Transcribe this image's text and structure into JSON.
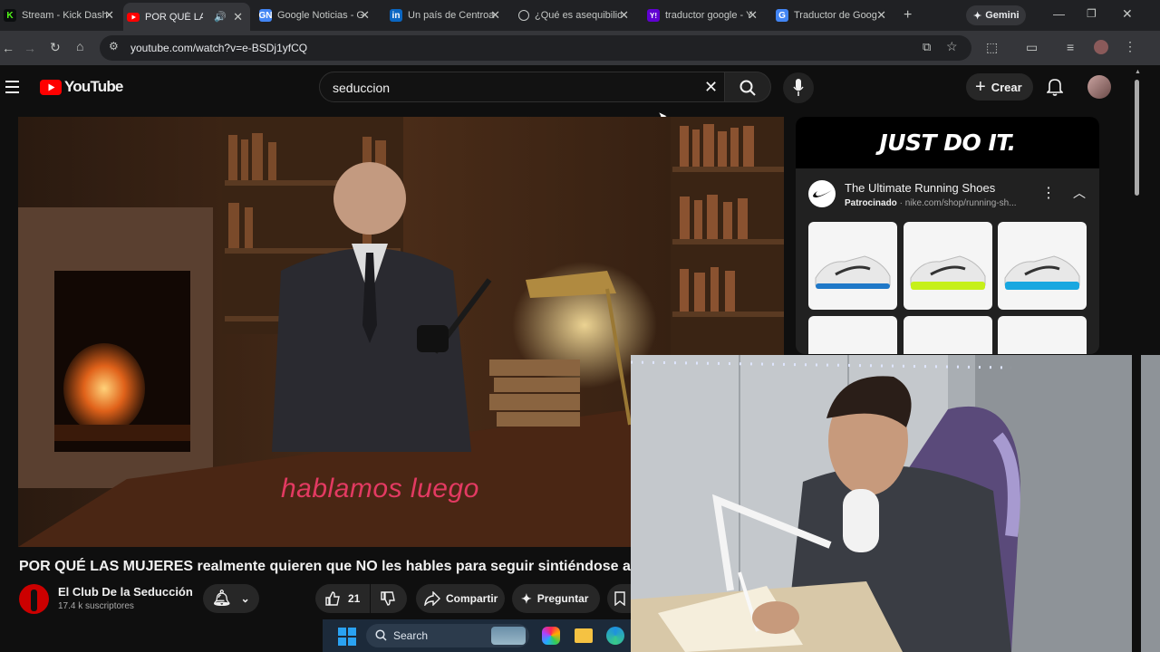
{
  "browser": {
    "tabs": [
      {
        "title": "Stream - Kick Dash",
        "favicon": "K",
        "favicon_color": "#53fc18",
        "active": false
      },
      {
        "title": "POR QUÉ LAS MUJ",
        "favicon": "youtube-icon",
        "favicon_color": "#ff0000",
        "active": true
      },
      {
        "title": "Google Noticias - G",
        "favicon": "G",
        "favicon_color": "#4285f4",
        "active": false
      },
      {
        "title": "Un país de Centroa",
        "favicon": "in",
        "favicon_color": "#0a66c2",
        "active": false
      },
      {
        "title": "¿Qué es asequibilida",
        "favicon": "chatgpt-icon",
        "favicon_color": "#c4c7c5",
        "active": false
      },
      {
        "title": "traductor google - Y",
        "favicon": "Y!",
        "favicon_color": "#6001d2",
        "active": false
      },
      {
        "title": "Traductor de Goog",
        "favicon": "G",
        "favicon_color": "#4285f4",
        "active": false
      }
    ],
    "gemini_label": "Gemini",
    "url": "youtube.com/watch?v=e-BSDj1yfCQ"
  },
  "youtube": {
    "logo_text": "YouTube",
    "search_value": "seduccion",
    "create_label": "Crear",
    "video": {
      "subtitle": "hablamos luego",
      "title": "POR QUÉ LAS MUJERES realmente quieren que NO les hables para seguir sintiéndose atra"
    },
    "channel": {
      "name": "El Club De la Seducción",
      "subscribers": "17.4 k suscriptores"
    },
    "actions": {
      "like_count": "21",
      "share_label": "Compartir",
      "ask_label": "Preguntar"
    },
    "ad": {
      "slogan": "JUST DO IT.",
      "title": "The Ultimate Running Shoes",
      "sponsored": "Patrocinado",
      "domain": "nike.com/shop/running-sh...",
      "shoe_accents": [
        "#1f78c8",
        "#c6f01a",
        "#19a7e0"
      ]
    }
  },
  "taskbar": {
    "search_label": "Search"
  }
}
